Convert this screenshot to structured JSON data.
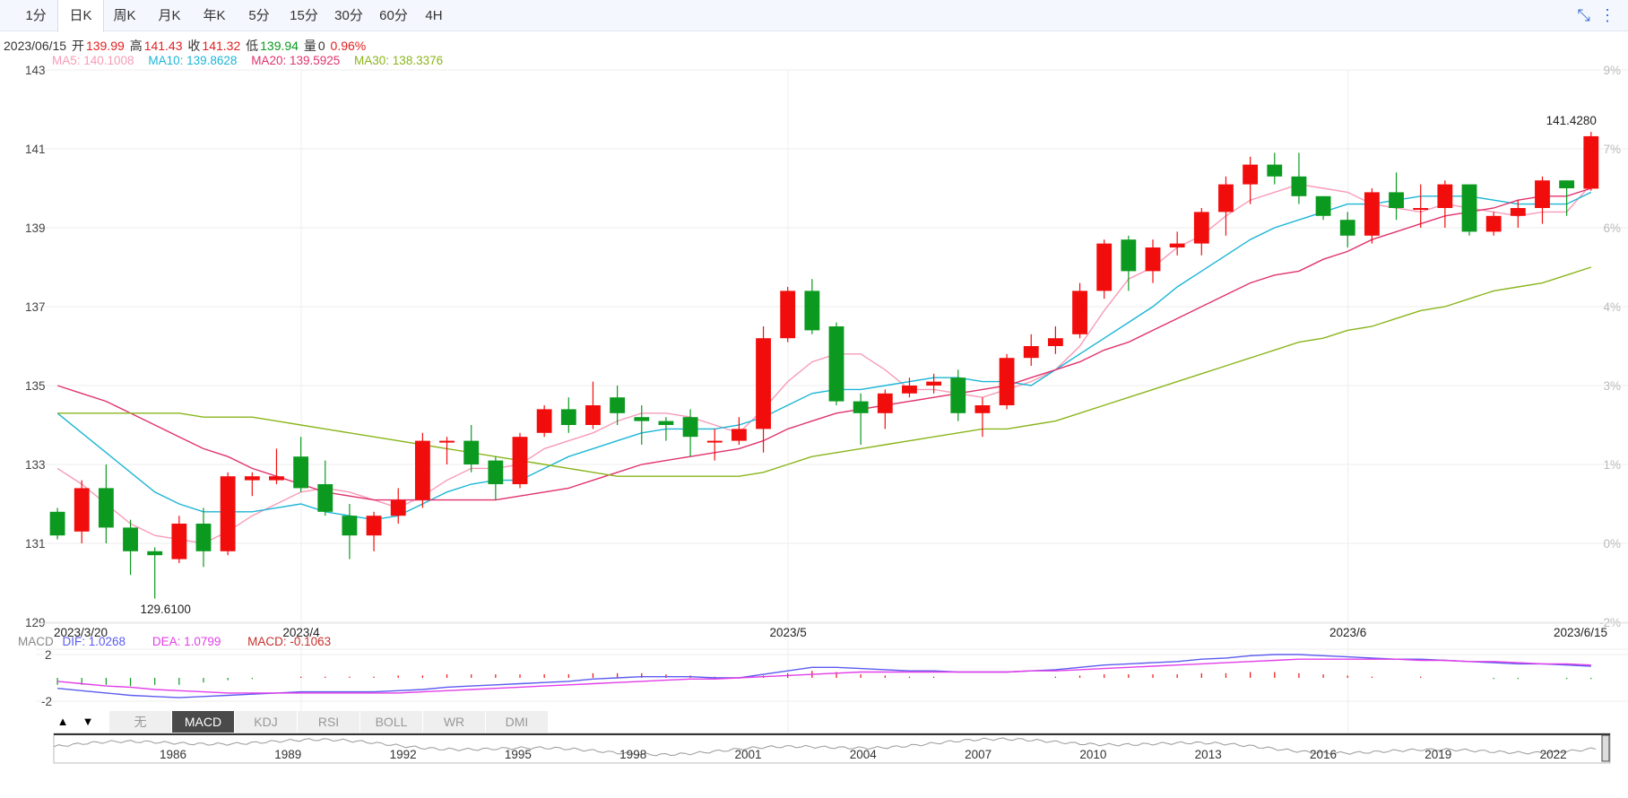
{
  "period_tabs": [
    {
      "label": "1分",
      "active": false
    },
    {
      "label": "日K",
      "active": true
    },
    {
      "label": "周K",
      "active": false
    },
    {
      "label": "月K",
      "active": false
    },
    {
      "label": "年K",
      "active": false
    },
    {
      "label": "5分",
      "active": false
    },
    {
      "label": "15分",
      "active": false
    },
    {
      "label": "30分",
      "active": false
    },
    {
      "label": "60分",
      "active": false
    },
    {
      "label": "4H",
      "active": false
    }
  ],
  "toolbar_icons": [
    "collapse-icon",
    "more-vertical-icon"
  ],
  "quote": {
    "date": "2023/06/15",
    "open_label": "开",
    "open": "139.99",
    "high_label": "高",
    "high": "141.43",
    "close_label": "收",
    "close": "141.32",
    "low_label": "低",
    "low": "139.94",
    "volume_label": "量",
    "volume": "0",
    "change": "0.96%"
  },
  "ma": [
    {
      "label": "MA5: 140.1008",
      "color": "#f79bb7"
    },
    {
      "label": "MA10: 139.8628",
      "color": "#1cb5d6"
    },
    {
      "label": "MA20: 139.5925",
      "color": "#e0336c"
    },
    {
      "label": "MA30: 138.3376",
      "color": "#8ab51c"
    }
  ],
  "colors": {
    "up": "#f20d0d",
    "down": "#0b9a1f",
    "grid": "#eeeeee",
    "dif": "#5b5bf0",
    "dea": "#e23ee8",
    "macd_label": "#c9302c"
  },
  "chart_data": {
    "type": "candlestick",
    "ylim": [
      129,
      143
    ],
    "yticks": [
      "129",
      "131",
      "133",
      "135",
      "137",
      "139",
      "141",
      "143"
    ],
    "pct_ticks": [
      "-2%",
      "0%",
      "1%",
      "3%",
      "4%",
      "6%",
      "7%",
      "9%"
    ],
    "x_labels": [
      {
        "label": "2023/3/20",
        "index": 0
      },
      {
        "label": "2023/4",
        "index": 10
      },
      {
        "label": "2023/5",
        "index": 30
      },
      {
        "label": "2023/6",
        "index": 53
      },
      {
        "label": "2023/6/15",
        "index": 63
      }
    ],
    "annotations": [
      {
        "label": "129.6100",
        "index": 4,
        "value": 129.61
      },
      {
        "label": "141.4280",
        "index": 63,
        "value": 141.428
      }
    ],
    "candles": [
      [
        131.8,
        131.2,
        131.9,
        131.1
      ],
      [
        131.3,
        132.4,
        132.6,
        131.0
      ],
      [
        132.4,
        131.4,
        133.0,
        131.0
      ],
      [
        131.4,
        130.8,
        131.6,
        130.2
      ],
      [
        130.8,
        130.7,
        130.9,
        129.6
      ],
      [
        130.6,
        131.5,
        131.7,
        130.5
      ],
      [
        131.5,
        130.8,
        131.9,
        130.4
      ],
      [
        130.8,
        132.7,
        132.8,
        130.7
      ],
      [
        132.6,
        132.7,
        132.8,
        132.2
      ],
      [
        132.6,
        132.7,
        133.4,
        132.5
      ],
      [
        133.2,
        132.4,
        133.7,
        132.3
      ],
      [
        132.5,
        131.8,
        133.1,
        131.7
      ],
      [
        131.7,
        131.2,
        132.0,
        130.6
      ],
      [
        131.2,
        131.7,
        131.8,
        130.8
      ],
      [
        131.7,
        132.1,
        132.4,
        131.5
      ],
      [
        132.1,
        133.6,
        133.8,
        131.9
      ],
      [
        133.6,
        133.6,
        133.7,
        133.0
      ],
      [
        133.6,
        133.0,
        134.0,
        132.8
      ],
      [
        133.1,
        132.5,
        133.2,
        132.1
      ],
      [
        132.5,
        133.7,
        133.8,
        132.4
      ],
      [
        133.8,
        134.4,
        134.5,
        133.7
      ],
      [
        134.4,
        134.0,
        134.7,
        133.8
      ],
      [
        134.0,
        134.5,
        135.1,
        133.9
      ],
      [
        134.7,
        134.3,
        135.0,
        134.0
      ],
      [
        134.2,
        134.1,
        134.5,
        133.5
      ],
      [
        134.1,
        134.0,
        134.2,
        133.6
      ],
      [
        134.2,
        133.7,
        134.4,
        133.2
      ],
      [
        133.6,
        133.6,
        133.9,
        133.1
      ],
      [
        133.6,
        133.9,
        134.2,
        133.5
      ],
      [
        133.9,
        136.2,
        136.5,
        133.3
      ],
      [
        136.2,
        137.4,
        137.5,
        136.1
      ],
      [
        137.4,
        136.4,
        137.7,
        136.3
      ],
      [
        136.5,
        134.6,
        136.6,
        134.5
      ],
      [
        134.6,
        134.3,
        134.8,
        133.5
      ],
      [
        134.3,
        134.8,
        134.9,
        133.9
      ],
      [
        134.8,
        135.0,
        135.2,
        134.7
      ],
      [
        135.0,
        135.1,
        135.3,
        134.8
      ],
      [
        135.2,
        134.3,
        135.4,
        134.1
      ],
      [
        134.3,
        134.5,
        134.7,
        133.7
      ],
      [
        134.5,
        135.7,
        135.8,
        134.4
      ],
      [
        135.7,
        136.0,
        136.3,
        135.5
      ],
      [
        136.0,
        136.2,
        136.5,
        135.8
      ],
      [
        136.3,
        137.4,
        137.6,
        136.2
      ],
      [
        137.4,
        138.6,
        138.7,
        137.2
      ],
      [
        138.7,
        137.9,
        138.8,
        137.4
      ],
      [
        137.9,
        138.5,
        138.7,
        137.6
      ],
      [
        138.5,
        138.6,
        138.9,
        138.3
      ],
      [
        138.6,
        139.4,
        139.5,
        138.3
      ],
      [
        139.4,
        140.1,
        140.3,
        138.8
      ],
      [
        140.1,
        140.6,
        140.8,
        139.6
      ],
      [
        140.6,
        140.3,
        140.9,
        140.1
      ],
      [
        140.3,
        139.8,
        140.9,
        139.6
      ],
      [
        139.8,
        139.3,
        139.8,
        139.2
      ],
      [
        139.2,
        138.8,
        139.4,
        138.5
      ],
      [
        138.8,
        139.9,
        140.0,
        138.6
      ],
      [
        139.9,
        139.5,
        140.4,
        139.2
      ],
      [
        139.5,
        139.5,
        140.1,
        139.0
      ],
      [
        139.5,
        140.1,
        140.2,
        139.0
      ],
      [
        140.1,
        138.9,
        140.1,
        138.8
      ],
      [
        138.9,
        139.3,
        139.4,
        138.8
      ],
      [
        139.3,
        139.5,
        139.7,
        139.0
      ],
      [
        139.5,
        140.2,
        140.3,
        139.1
      ],
      [
        140.2,
        140.0,
        140.2,
        139.3
      ],
      [
        139.99,
        141.32,
        141.43,
        139.94
      ]
    ],
    "ma_series": [
      {
        "color": "#f79bb7",
        "values": [
          132.9,
          132.5,
          132.0,
          131.5,
          131.2,
          131.1,
          131.0,
          131.3,
          131.7,
          132.0,
          132.3,
          132.4,
          132.3,
          132.1,
          131.9,
          132.2,
          132.6,
          132.9,
          132.9,
          133.0,
          133.4,
          133.6,
          133.8,
          134.1,
          134.3,
          134.3,
          134.2,
          134.0,
          133.8,
          134.4,
          135.1,
          135.6,
          135.8,
          135.8,
          135.4,
          134.9,
          134.9,
          134.8,
          134.7,
          134.9,
          135.1,
          135.4,
          136.0,
          136.9,
          137.7,
          138.0,
          138.5,
          138.8,
          139.3,
          139.7,
          139.9,
          140.1,
          140.0,
          139.9,
          139.6,
          139.5,
          139.4,
          139.6,
          139.5,
          139.4,
          139.3,
          139.4,
          139.4,
          140.1
        ]
      },
      {
        "color": "#1cb5d6",
        "values": [
          134.3,
          133.8,
          133.3,
          132.8,
          132.3,
          132.0,
          131.8,
          131.8,
          131.8,
          131.9,
          132.0,
          131.8,
          131.7,
          131.6,
          131.7,
          132.0,
          132.3,
          132.5,
          132.6,
          132.6,
          132.9,
          133.2,
          133.4,
          133.6,
          133.8,
          133.9,
          133.9,
          133.9,
          134.0,
          134.2,
          134.5,
          134.8,
          134.9,
          134.9,
          135.0,
          135.1,
          135.2,
          135.2,
          135.1,
          135.1,
          135.0,
          135.4,
          135.8,
          136.2,
          136.6,
          137.0,
          137.5,
          137.9,
          138.3,
          138.7,
          139.0,
          139.2,
          139.4,
          139.6,
          139.6,
          139.7,
          139.8,
          139.8,
          139.8,
          139.7,
          139.6,
          139.6,
          139.6,
          139.9
        ]
      },
      {
        "color": "#e0336c",
        "values": [
          135.0,
          134.8,
          134.6,
          134.3,
          134.0,
          133.7,
          133.4,
          133.2,
          132.9,
          132.7,
          132.5,
          132.3,
          132.2,
          132.1,
          132.1,
          132.1,
          132.1,
          132.1,
          132.1,
          132.2,
          132.3,
          132.4,
          132.6,
          132.8,
          133.0,
          133.1,
          133.2,
          133.3,
          133.4,
          133.6,
          133.9,
          134.1,
          134.3,
          134.4,
          134.5,
          134.6,
          134.7,
          134.8,
          134.9,
          135.0,
          135.2,
          135.4,
          135.6,
          135.9,
          136.1,
          136.4,
          136.7,
          137.0,
          137.3,
          137.6,
          137.8,
          137.9,
          138.2,
          138.4,
          138.7,
          138.9,
          139.1,
          139.3,
          139.4,
          139.5,
          139.7,
          139.8,
          139.8,
          140.0
        ]
      },
      {
        "color": "#8ab51c",
        "values": [
          134.3,
          134.3,
          134.3,
          134.3,
          134.3,
          134.3,
          134.2,
          134.2,
          134.2,
          134.1,
          134.0,
          133.9,
          133.8,
          133.7,
          133.6,
          133.5,
          133.4,
          133.3,
          133.2,
          133.1,
          133.0,
          132.9,
          132.8,
          132.7,
          132.7,
          132.7,
          132.7,
          132.7,
          132.7,
          132.8,
          133.0,
          133.2,
          133.3,
          133.4,
          133.5,
          133.6,
          133.7,
          133.8,
          133.9,
          133.9,
          134.0,
          134.1,
          134.3,
          134.5,
          134.7,
          134.9,
          135.1,
          135.3,
          135.5,
          135.7,
          135.9,
          136.1,
          136.2,
          136.4,
          136.5,
          136.7,
          136.9,
          137.0,
          137.2,
          137.4,
          137.5,
          137.6,
          137.8,
          138.0
        ]
      }
    ],
    "macd": {
      "ylim": [
        -2,
        2
      ],
      "yticks": [
        "2",
        "-2"
      ],
      "dif": [
        -0.9,
        -1.1,
        -1.3,
        -1.5,
        -1.6,
        -1.7,
        -1.6,
        -1.5,
        -1.4,
        -1.3,
        -1.2,
        -1.2,
        -1.2,
        -1.2,
        -1.1,
        -1.0,
        -0.8,
        -0.7,
        -0.6,
        -0.5,
        -0.4,
        -0.3,
        -0.1,
        0.0,
        0.1,
        0.1,
        0.1,
        0.0,
        0.0,
        0.3,
        0.6,
        0.9,
        0.9,
        0.8,
        0.7,
        0.6,
        0.6,
        0.5,
        0.5,
        0.5,
        0.6,
        0.7,
        0.9,
        1.1,
        1.2,
        1.3,
        1.4,
        1.6,
        1.7,
        1.9,
        2.0,
        2.0,
        1.9,
        1.8,
        1.7,
        1.6,
        1.6,
        1.5,
        1.4,
        1.3,
        1.2,
        1.2,
        1.1,
        1.0
      ],
      "dea": [
        -0.3,
        -0.5,
        -0.7,
        -0.8,
        -1.0,
        -1.1,
        -1.2,
        -1.3,
        -1.3,
        -1.3,
        -1.3,
        -1.3,
        -1.3,
        -1.3,
        -1.3,
        -1.2,
        -1.1,
        -1.0,
        -0.9,
        -0.8,
        -0.7,
        -0.6,
        -0.5,
        -0.4,
        -0.3,
        -0.2,
        -0.1,
        -0.1,
        0.0,
        0.1,
        0.2,
        0.3,
        0.4,
        0.5,
        0.5,
        0.5,
        0.5,
        0.5,
        0.5,
        0.5,
        0.6,
        0.6,
        0.7,
        0.8,
        0.9,
        1.0,
        1.1,
        1.2,
        1.3,
        1.4,
        1.5,
        1.6,
        1.6,
        1.6,
        1.6,
        1.6,
        1.5,
        1.5,
        1.4,
        1.4,
        1.3,
        1.2,
        1.2,
        1.1
      ],
      "bar": [
        -0.6,
        -0.6,
        -0.6,
        -0.7,
        -0.6,
        -0.6,
        -0.4,
        -0.2,
        -0.1,
        0.0,
        0.1,
        0.1,
        0.1,
        0.1,
        0.2,
        0.2,
        0.3,
        0.3,
        0.3,
        0.3,
        0.3,
        0.3,
        0.4,
        0.4,
        0.4,
        0.3,
        0.2,
        0.1,
        0.0,
        0.2,
        0.4,
        0.6,
        0.5,
        0.3,
        0.2,
        0.1,
        0.1,
        0.0,
        0.0,
        0.0,
        0.0,
        0.1,
        0.2,
        0.3,
        0.3,
        0.3,
        0.3,
        0.4,
        0.4,
        0.5,
        0.5,
        0.4,
        0.3,
        0.2,
        0.1,
        0.0,
        0.1,
        0.0,
        0.0,
        -0.1,
        -0.1,
        0.0,
        -0.1,
        -0.1
      ]
    }
  },
  "macd_labels": {
    "name": "MACD",
    "dif": "DIF: 1.0268",
    "dea": "DEA: 1.0799",
    "macd": "MACD: -0.1063"
  },
  "indicator_tabs": [
    {
      "label": "无",
      "active": false
    },
    {
      "label": "MACD",
      "active": true
    },
    {
      "label": "KDJ",
      "active": false
    },
    {
      "label": "RSI",
      "active": false
    },
    {
      "label": "BOLL",
      "active": false
    },
    {
      "label": "WR",
      "active": false
    },
    {
      "label": "DMI",
      "active": false
    }
  ],
  "navigator": {
    "years": [
      "1986",
      "1989",
      "1992",
      "1995",
      "1998",
      "2001",
      "2004",
      "2007",
      "2010",
      "2013",
      "2016",
      "2019",
      "2022"
    ]
  }
}
